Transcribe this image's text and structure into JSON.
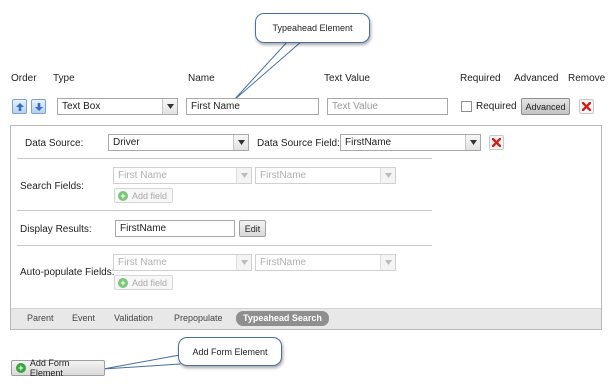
{
  "callouts": {
    "typeahead": "Typeahead Element",
    "add_form": "Add Form Element"
  },
  "headers": {
    "order": "Order",
    "type": "Type",
    "name": "Name",
    "text_value": "Text Value",
    "required": "Required",
    "advanced": "Advanced",
    "remove": "Remove"
  },
  "row": {
    "type_value": "Text Box",
    "name_value": "First Name",
    "text_value_placeholder": "Text Value",
    "required_label": "Required",
    "required_checked": false,
    "advanced_label": "Advanced"
  },
  "advanced": {
    "data_source_label": "Data Source:",
    "data_source_value": "Driver",
    "data_source_field_label": "Data Source Field:",
    "data_source_field_value": "FirstName",
    "search_fields": {
      "label": "Search Fields:",
      "field_value": "First Name",
      "db_field_value": "FirstName",
      "add_label": "Add field"
    },
    "display_results": {
      "label": "Display Results:",
      "value": "FirstName",
      "edit_label": "Edit"
    },
    "auto_populate": {
      "label": "Auto-populate Fields:",
      "field_value": "First Name",
      "db_field_value": "FirstName",
      "add_label": "Add field"
    }
  },
  "tabs": [
    {
      "label": "Parent",
      "active": false
    },
    {
      "label": "Event",
      "active": false
    },
    {
      "label": "Validation",
      "active": false
    },
    {
      "label": "Prepopulate",
      "active": false
    },
    {
      "label": "Typeahead Search",
      "active": true
    }
  ],
  "add_form_element_label": "Add Form Element",
  "icons": {
    "up": "arrow-up-icon",
    "down": "arrow-down-icon",
    "remove": "red-x-icon",
    "add": "green-plus-icon",
    "dropdown": "chevron-down-icon"
  },
  "colors": {
    "remove_red": "#c8241b",
    "add_green": "#3aa53a",
    "arrow_blue": "#2f6fc4",
    "active_tab": "#8f8f8f"
  }
}
